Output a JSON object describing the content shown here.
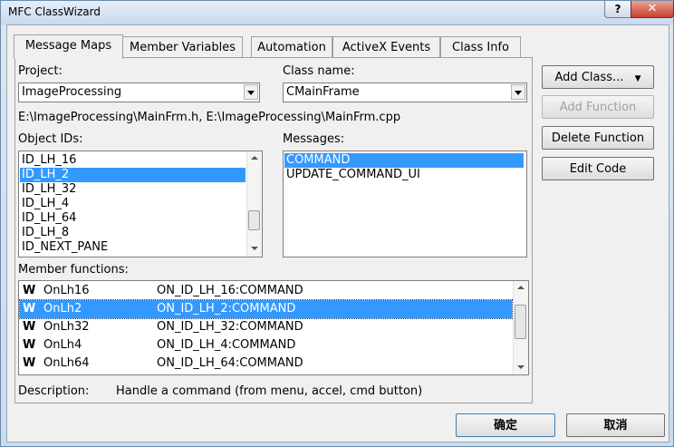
{
  "window": {
    "title": "MFC ClassWizard",
    "help": "?",
    "close": "✕"
  },
  "tabs": [
    "Message Maps",
    "Member Variables",
    "Automation",
    "ActiveX Events",
    "Class Info"
  ],
  "project": {
    "label": "Project:",
    "value": "ImageProcessing"
  },
  "class_name": {
    "label": "Class name:",
    "value": "CMainFrame"
  },
  "file_path": "E:\\ImageProcessing\\MainFrm.h, E:\\ImageProcessing\\MainFrm.cpp",
  "object_ids": {
    "label": "Object IDs:",
    "items": [
      "ID_LH_16",
      "ID_LH_2",
      "ID_LH_32",
      "ID_LH_4",
      "ID_LH_64",
      "ID_LH_8",
      "ID_NEXT_PANE"
    ],
    "selected_index": 1
  },
  "messages": {
    "label": "Messages:",
    "items": [
      "COMMAND",
      "UPDATE_COMMAND_UI"
    ],
    "selected_index": 0
  },
  "member_functions": {
    "label": "Member functions:",
    "rows": [
      {
        "icon": "W",
        "name": "OnLh16",
        "message": "ON_ID_LH_16:COMMAND"
      },
      {
        "icon": "W",
        "name": "OnLh2",
        "message": "ON_ID_LH_2:COMMAND"
      },
      {
        "icon": "W",
        "name": "OnLh32",
        "message": "ON_ID_LH_32:COMMAND"
      },
      {
        "icon": "W",
        "name": "OnLh4",
        "message": "ON_ID_LH_4:COMMAND"
      },
      {
        "icon": "W",
        "name": "OnLh64",
        "message": "ON_ID_LH_64:COMMAND"
      }
    ],
    "selected_index": 1
  },
  "description": {
    "label": "Description:",
    "text": "Handle a command (from menu, accel, cmd button)"
  },
  "buttons": {
    "add_class": "Add Class...",
    "add_class_arrow": "▼",
    "add_function": "Add Function",
    "delete_function": "Delete Function",
    "edit_code": "Edit Code",
    "ok": "确定",
    "cancel": "取消"
  }
}
